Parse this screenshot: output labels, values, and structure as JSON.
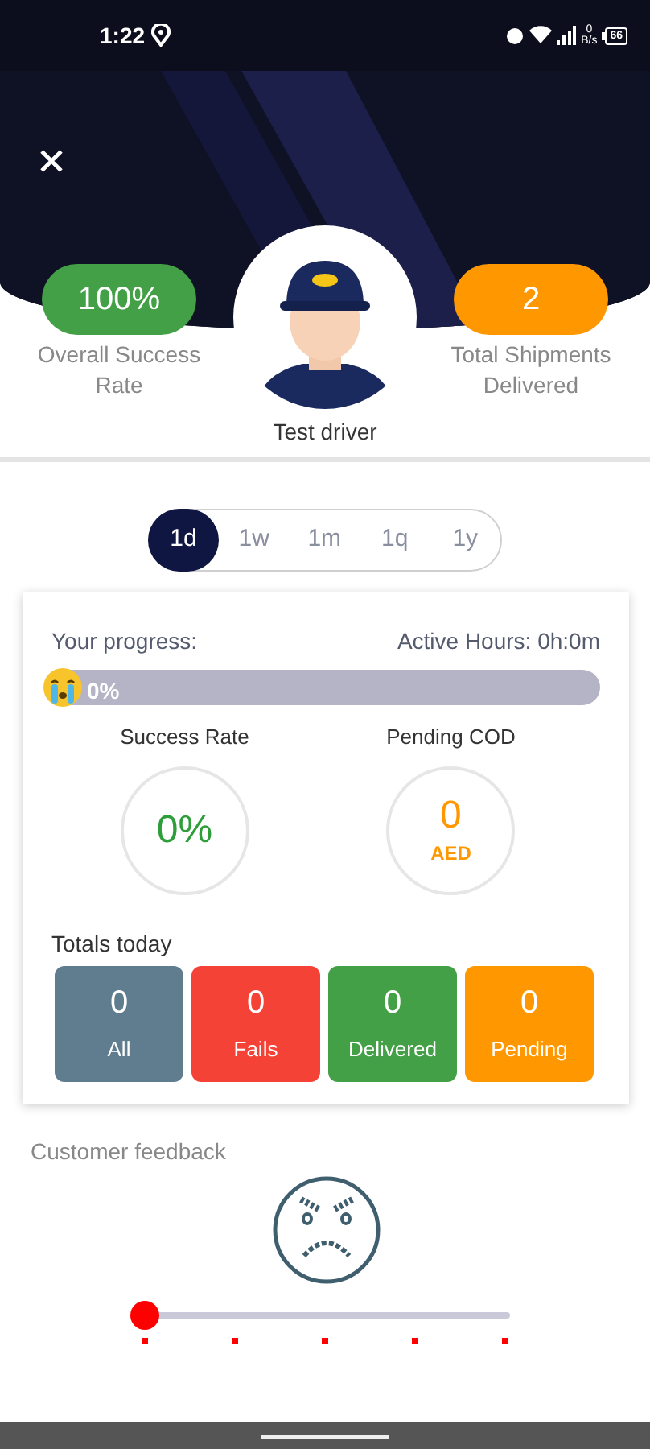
{
  "status_bar": {
    "time": "1:22",
    "net_speed": "0",
    "net_unit": "B/s",
    "battery": "66"
  },
  "profile": {
    "name": "Test driver",
    "stats": [
      {
        "value": "100%",
        "label": "Overall Success Rate",
        "color": "#43a047"
      },
      {
        "value": "2",
        "label": "Total Shipments Delivered",
        "color": "#ff9800"
      }
    ]
  },
  "periods": [
    {
      "label": "1d",
      "selected": true
    },
    {
      "label": "1w",
      "selected": false
    },
    {
      "label": "1m",
      "selected": false
    },
    {
      "label": "1q",
      "selected": false
    },
    {
      "label": "1y",
      "selected": false
    }
  ],
  "progress": {
    "label": "Your progress:",
    "active_hours": "Active Hours: 0h:0m",
    "level": 0,
    "reading": "0%"
  },
  "gauges": [
    {
      "title": "Success Rate",
      "value": "0%",
      "kind": "percent"
    },
    {
      "title": "Pending COD",
      "value": "0",
      "unit": "AED",
      "kind": "currency"
    }
  ],
  "totals": {
    "title": "Totals today",
    "items": [
      {
        "value": "0",
        "label": "All",
        "color": "#5f7d8e"
      },
      {
        "value": "0",
        "label": "Fails",
        "color": "#f44336"
      },
      {
        "value": "0",
        "label": "Delivered",
        "color": "#43a047"
      },
      {
        "value": "0",
        "label": "Pending",
        "color": "#ff9800"
      }
    ]
  },
  "feedback": {
    "title": "Customer feedback",
    "level": 0
  }
}
